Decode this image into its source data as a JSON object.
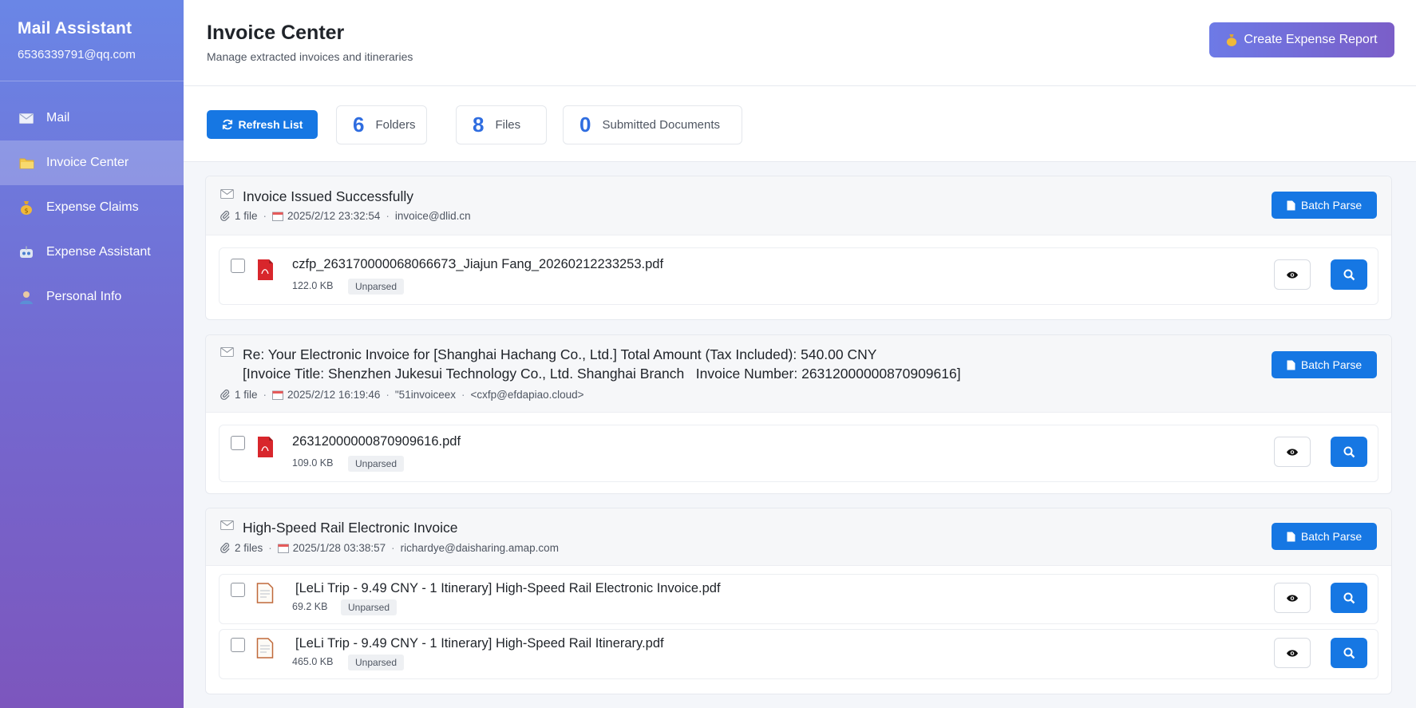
{
  "sidebar": {
    "app_title": "Mail Assistant",
    "account_email": "6536339791@qq.com",
    "items": [
      {
        "label": "Mail",
        "icon": "envelope-icon"
      },
      {
        "label": "Invoice Center",
        "icon": "folder-icon"
      },
      {
        "label": "Expense Claims",
        "icon": "money-bag-icon"
      },
      {
        "label": "Expense Assistant",
        "icon": "robot-icon"
      },
      {
        "label": "Personal Info",
        "icon": "user-icon"
      }
    ],
    "active_index": 1
  },
  "header": {
    "title": "Invoice Center",
    "subtitle": "Manage extracted invoices and itineraries",
    "create_button": "Create Expense Report"
  },
  "toolbar": {
    "refresh_label": "Refresh List",
    "stats": [
      {
        "value": "6",
        "label": "Folders"
      },
      {
        "value": "8",
        "label": "Files"
      },
      {
        "value": "0",
        "label": "Submitted Documents"
      }
    ]
  },
  "groups": [
    {
      "title_line1": "Invoice Issued Successfully",
      "title_line2": "",
      "file_count": "1 file",
      "datetime": "2025/2/12 23:32:54",
      "sender": "invoice@dlid.cn",
      "sender_extra": "",
      "batch_label": "Batch Parse",
      "files": [
        {
          "name": "czfp_26317000006806667З_Jiajun Fang_20260212233253.pdf",
          "size": "122.0 KB",
          "status": "Unparsed",
          "icon": "pdf-red-icon"
        }
      ]
    },
    {
      "title_line1": "Re: Your Electronic Invoice for [Shanghai Hachang Co., Ltd.] Total Amount (Tax Included): 540.00 CNY",
      "title_line2": "[Invoice Title: Shenzhen Jukesui Technology Co., Ltd. Shanghai Branch   Invoice Number: 26312000000870909616]",
      "file_count": "1 file",
      "datetime": "2025/2/12 16:19:46",
      "sender": "\"51invoiceex",
      "sender_extra": "<cxfp@efdapiao.cloud>",
      "batch_label": "Batch Parse",
      "files": [
        {
          "name": "26312000000870909616.pdf",
          "size": "109.0 KB",
          "status": "Unparsed",
          "icon": "pdf-red-icon"
        }
      ]
    },
    {
      "title_line1": "High-Speed Rail Electronic Invoice",
      "title_line2": "",
      "file_count": "2 files",
      "datetime": "2025/1/28 03:38:57",
      "sender": "richardye@daisharing.amap.com",
      "sender_extra": "",
      "batch_label": "Batch Parse",
      "files": [
        {
          "name": "[LeLi Trip - 9.49 CNY - 1 Itinerary]  High-Speed Rail Electronic Invoice.pdf",
          "size": "69.2 KB",
          "status": "Unparsed",
          "icon": "document-icon"
        },
        {
          "name": "[LeLi Trip - 9.49 CNY - 1 Itinerary]  High-Speed Rail Itinerary.pdf",
          "size": "465.0 KB",
          "status": "Unparsed",
          "icon": "document-icon"
        }
      ]
    }
  ]
}
